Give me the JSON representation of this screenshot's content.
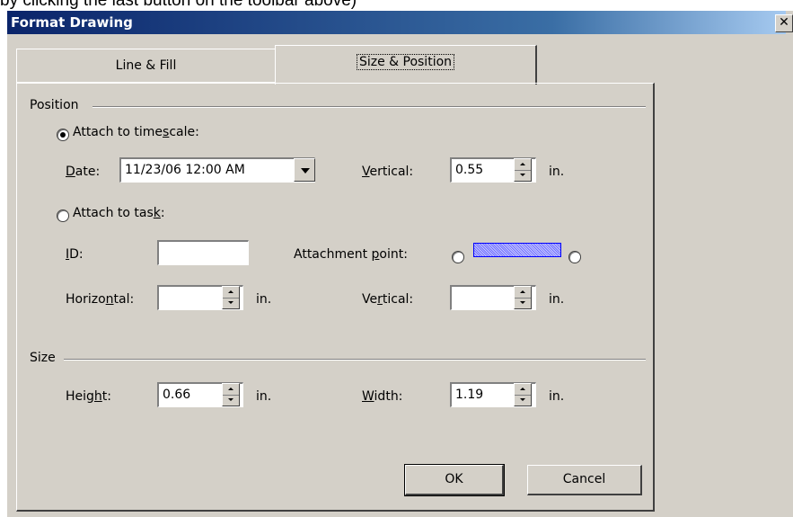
{
  "background_caption": "by clicking the last button on the toolbar above)",
  "dialog": {
    "title": "Format Drawing",
    "close_symbol": "✕"
  },
  "tabs": [
    {
      "label": "Line & Fill",
      "active": false
    },
    {
      "label": "Size & Position",
      "active": true
    }
  ],
  "position_group": {
    "title": "Position",
    "attach_timescale": {
      "label_pre": "Attach to time",
      "label_u": "s",
      "label_post": "cale:",
      "selected": true
    },
    "date": {
      "label_u": "D",
      "label_post": "ate:",
      "value": "11/23/06 12:00 AM"
    },
    "vertical_top": {
      "label_u": "V",
      "label_post": "ertical:",
      "value": "0.55",
      "unit": "in."
    },
    "attach_task": {
      "label_pre": "Attach to tas",
      "label_u": "k",
      "label_post": ":",
      "selected": false
    },
    "id": {
      "label_u": "I",
      "label_post": "D:",
      "value": ""
    },
    "attachment_point": {
      "label_pre": "Attachment ",
      "label_u": "p",
      "label_post": "oint:"
    },
    "horizontal": {
      "label_pre": "Horizo",
      "label_u": "n",
      "label_post": "tal:",
      "value": "",
      "unit": "in."
    },
    "vertical_task": {
      "label_pre": "Ve",
      "label_u": "r",
      "label_post": "tical:",
      "value": "",
      "unit": "in."
    }
  },
  "size_group": {
    "title": "Size",
    "height": {
      "label_pre": "Heig",
      "label_u": "h",
      "label_post": "t:",
      "value": "0.66",
      "unit": "in."
    },
    "width": {
      "label_u": "W",
      "label_post": "idth:",
      "value": "1.19",
      "unit": "in."
    }
  },
  "buttons": {
    "ok": "OK",
    "cancel": "Cancel"
  },
  "colors": {
    "title_bar": "#0a246a",
    "face": "#d4d0c8",
    "pattern": "#7070ff"
  }
}
